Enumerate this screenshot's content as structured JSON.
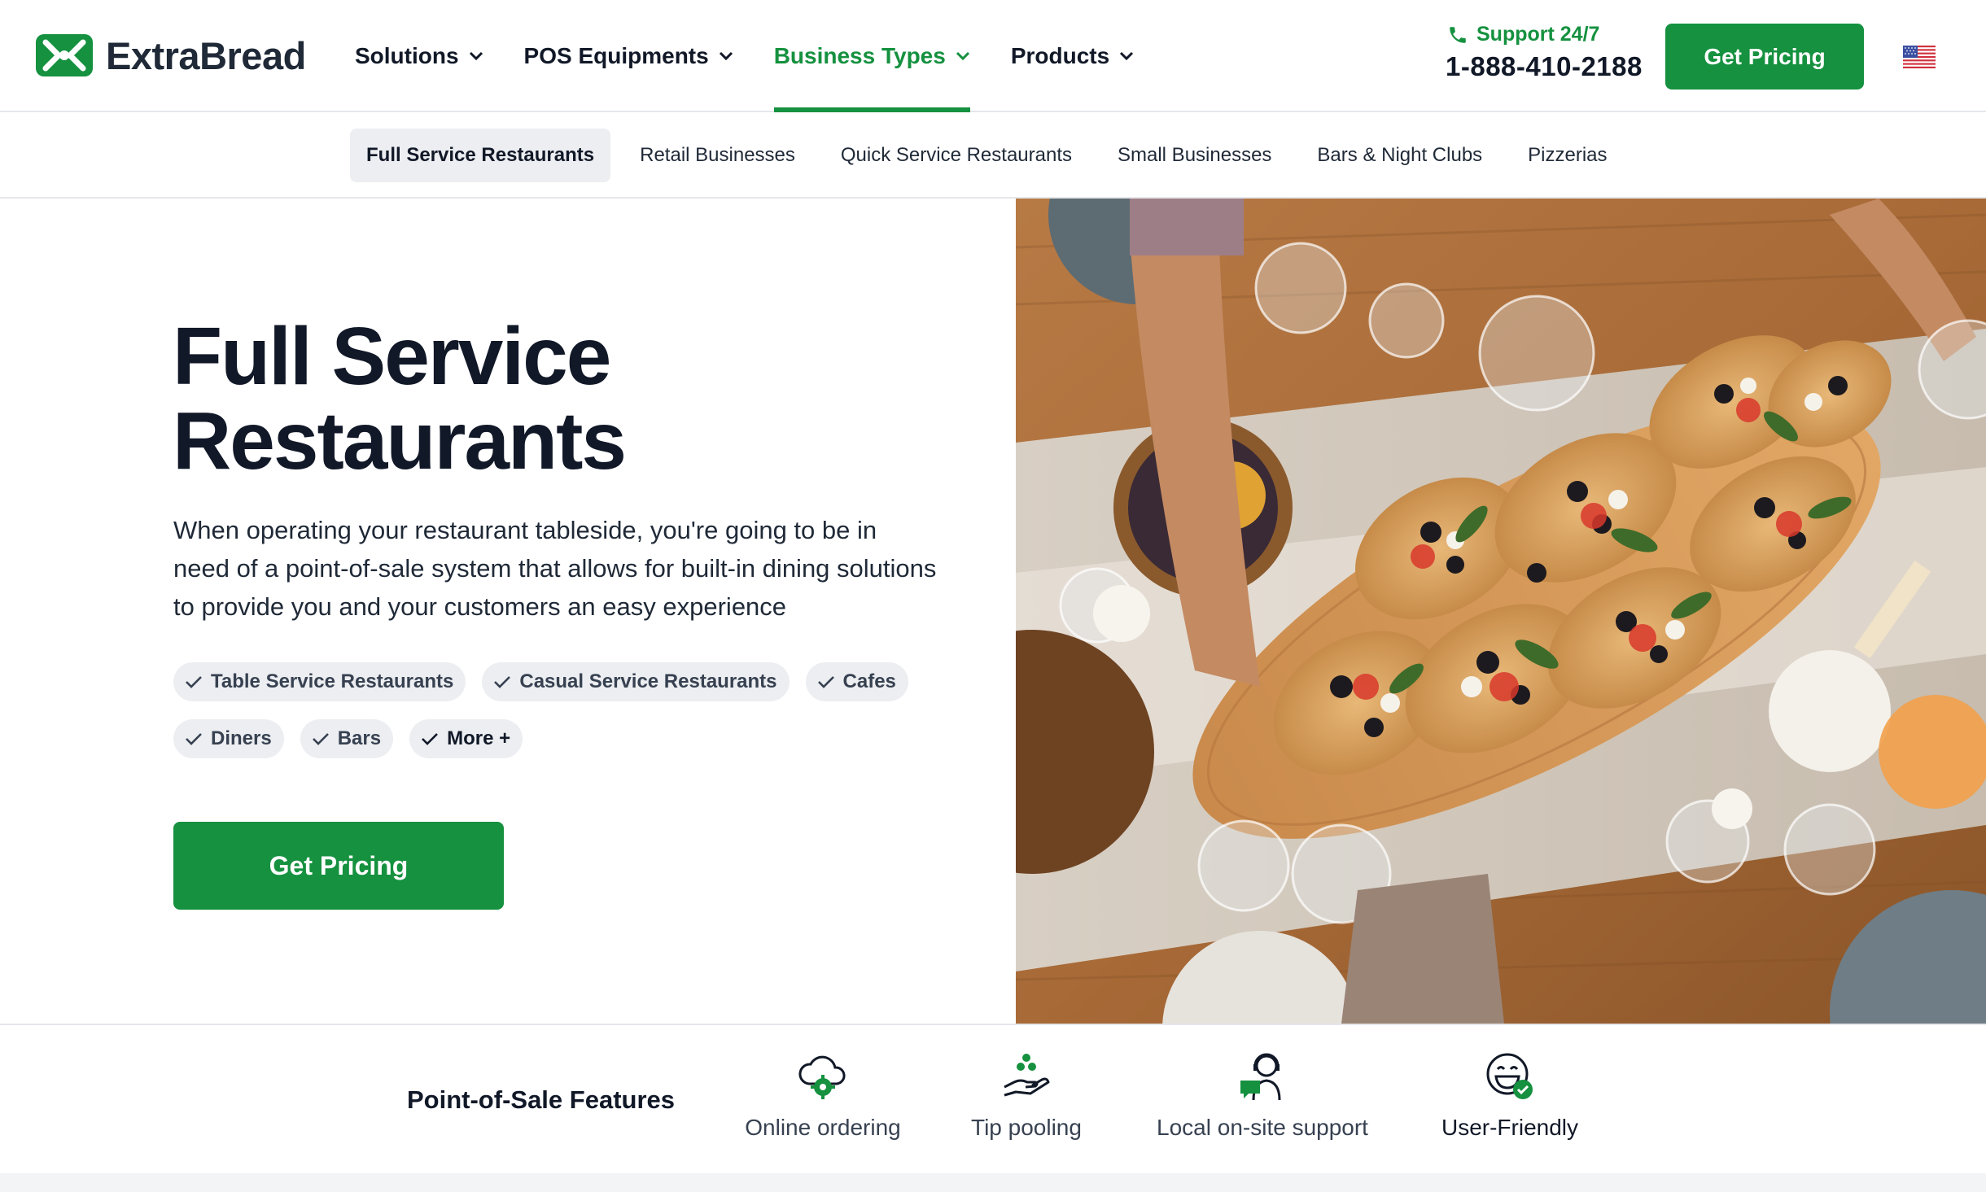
{
  "brand": {
    "name": "ExtraBread",
    "accent_color": "#15913f"
  },
  "nav": {
    "items": [
      {
        "label": "Solutions",
        "icon": "chevron-down-icon"
      },
      {
        "label": "POS Equipments",
        "icon": "chevron-down-icon"
      },
      {
        "label": "Business Types",
        "icon": "chevron-down-icon",
        "active": true
      },
      {
        "label": "Products",
        "icon": "chevron-down-icon"
      }
    ]
  },
  "support": {
    "label": "Support 24/7",
    "phone": "1-888-410-2188",
    "icon": "phone-icon"
  },
  "header_cta": {
    "label": "Get Pricing"
  },
  "locale": {
    "icon": "us-flag-icon"
  },
  "subnav": {
    "items": [
      {
        "label": "Full Service Restaurants",
        "active": true
      },
      {
        "label": "Retail Businesses"
      },
      {
        "label": "Quick Service Restaurants"
      },
      {
        "label": "Small Businesses"
      },
      {
        "label": "Bars & Night Clubs"
      },
      {
        "label": "Pizzerias"
      }
    ]
  },
  "hero": {
    "title_line1": "Full Service",
    "title_line2": "Restaurants",
    "description": "When operating your restaurant tableside, you're going to be in need of a point-of-sale system that allows for built-in dining solutions to provide you and your customers an easy experience",
    "chips": [
      "Table Service Restaurants",
      "Casual Service Restaurants",
      "Cafes",
      "Diners",
      "Bars",
      "More +"
    ],
    "cta_label": "Get Pricing",
    "image": "photo-overhead-table-with-pizza-board"
  },
  "features": {
    "title": "Point-of-Sale Features",
    "items": [
      {
        "label": "Online ordering",
        "icon": "cloud-gear-icon"
      },
      {
        "label": "Tip pooling",
        "icon": "hand-coins-icon"
      },
      {
        "label": "Local on-site support",
        "icon": "support-agent-icon"
      },
      {
        "label": "User-Friendly",
        "icon": "smiley-check-icon"
      }
    ]
  }
}
